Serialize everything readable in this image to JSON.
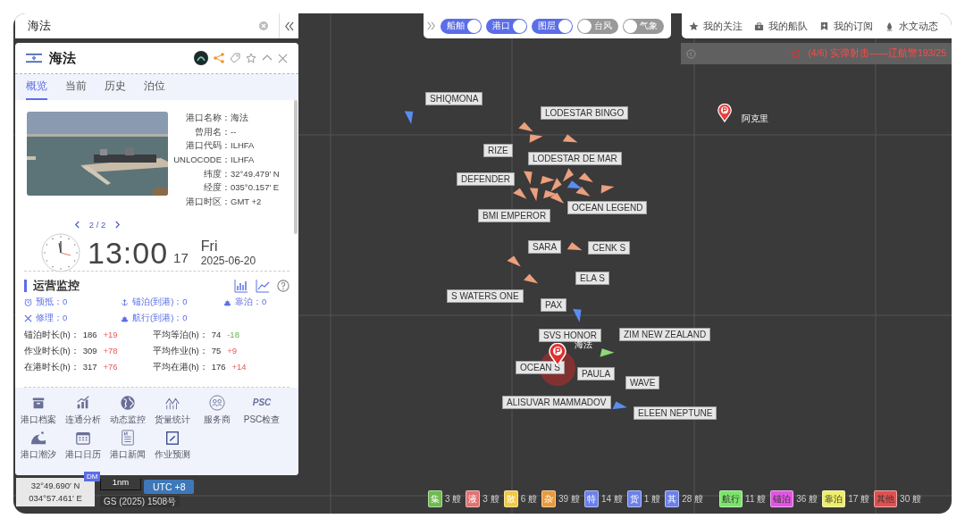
{
  "search": {
    "value": "海法"
  },
  "port_card": {
    "title": "海法",
    "tabs": [
      {
        "label": "概览",
        "selected": true
      },
      {
        "label": "当前",
        "selected": false
      },
      {
        "label": "历史",
        "selected": false
      },
      {
        "label": "泊位",
        "selected": false
      }
    ],
    "info": [
      {
        "label": "港口名称：",
        "value": "海法"
      },
      {
        "label": "曾用名：",
        "value": "--"
      },
      {
        "label": "港口代码：",
        "value": "ILHFA"
      },
      {
        "label": "UNLOCODE：",
        "value": "ILHFA"
      },
      {
        "label": "纬度：",
        "value": "32°49.479′ N"
      },
      {
        "label": "经度：",
        "value": "035°0.157′ E"
      },
      {
        "label": "港口时区：",
        "value": "GMT +2"
      }
    ],
    "pager": "2 / 2",
    "clock": {
      "time": "13:00",
      "seconds": "17",
      "weekday": "Fri",
      "date": "2025-06-20"
    },
    "operations": {
      "title": "运营监控",
      "status": [
        {
          "kind": "alarm",
          "label": "预抵：",
          "value": "0"
        },
        {
          "kind": "anchor",
          "label": "锚泊(到港)：",
          "value": "0"
        },
        {
          "kind": "ship",
          "label": "靠泊：",
          "value": "0"
        },
        {
          "kind": "repair",
          "label": "修理：",
          "value": "0"
        },
        {
          "kind": "ship",
          "label": "航行(到港)：",
          "value": "0"
        }
      ],
      "metrics": [
        {
          "label": "锚泊时长(h)：",
          "value": "186",
          "change": "+19",
          "kind": "rise"
        },
        {
          "label": "平均等泊(h)：",
          "value": "74",
          "change": "-18",
          "kind": "fall"
        },
        {
          "label": "作业时长(h)：",
          "value": "309",
          "change": "+78",
          "kind": "rise"
        },
        {
          "label": "平均作业(h)：",
          "value": "75",
          "change": "+9",
          "kind": "rise"
        },
        {
          "label": "在港时长(h)：",
          "value": "317",
          "change": "+76",
          "kind": "rise"
        },
        {
          "label": "平均在港(h)：",
          "value": "176",
          "change": "+14",
          "kind": "rise"
        }
      ]
    },
    "shortcuts": [
      {
        "kind": "archive",
        "label": "港口档案"
      },
      {
        "kind": "bars",
        "label": "连通分析"
      },
      {
        "kind": "globe",
        "label": "动态监控"
      },
      {
        "kind": "stats",
        "label": "货量统计"
      },
      {
        "kind": "people",
        "label": "服务商"
      },
      {
        "kind": "text",
        "icon_text": "PSC",
        "label": "PSC检查"
      },
      {
        "kind": "wave",
        "label": "港口潮汐"
      },
      {
        "kind": "calendar",
        "label": "港口日历"
      },
      {
        "kind": "news",
        "label": "港口新闻"
      },
      {
        "kind": "edit",
        "label": "作业预测"
      }
    ]
  },
  "map_controls": {
    "coordinates": [
      "32°49.690′ N",
      "034°57.461′ E"
    ],
    "badge": "DM",
    "scale": "1nm",
    "timezone": "UTC +8",
    "approval": "GS (2025) 1508号"
  },
  "layer_toggles": [
    {
      "label": "船舶",
      "on": true
    },
    {
      "label": "港口",
      "on": true
    },
    {
      "label": "图层",
      "on": true
    },
    {
      "label": "台风",
      "on": false
    },
    {
      "label": "气象",
      "on": false
    }
  ],
  "top_menu": [
    {
      "kind": "star",
      "label": "我的关注"
    },
    {
      "kind": "fleet",
      "label": "我的船队"
    },
    {
      "kind": "bookmark",
      "label": "我的订阅"
    },
    {
      "kind": "hydro",
      "label": "水文动态"
    }
  ],
  "notice": "(4/6) 实弹射击——辽航警193/25",
  "map_labels": {
    "ships": [
      "SHIQMONA",
      "LODESTAR BINGO",
      "RIZE",
      "LODESTAR DE MAR",
      "DEFENDER",
      "BMI EMPEROR",
      "OCEAN LEGEND",
      "SARA",
      "CENK S",
      "ELA S",
      "S WATERS ONE",
      "PAX",
      "SVS HONOR",
      "ZIM NEW ZEALAND",
      "OCEAN S",
      "PAULA",
      "WAVE",
      "ALISUVAR MAMMADOV",
      "ELEEN NEPTUNE"
    ],
    "ports": [
      {
        "name": "阿克里",
        "selected": false
      },
      {
        "name": "海法",
        "selected": true
      }
    ]
  },
  "legend": {
    "ship_types": [
      {
        "label": "集",
        "count": "3 艘",
        "color": "#6dbb4f"
      },
      {
        "label": "液",
        "count": "3 艘",
        "color": "#e07272"
      },
      {
        "label": "散",
        "count": "6 艘",
        "color": "#f2c843"
      },
      {
        "label": "杂",
        "count": "39 艘",
        "color": "#e89a3c"
      },
      {
        "label": "特",
        "count": "14 艘",
        "color": "#6b80ea"
      },
      {
        "label": "货",
        "count": "1 艘",
        "color": "#6b80ea"
      },
      {
        "label": "其",
        "count": "28 艘",
        "color": "#6b80ea"
      }
    ],
    "ship_states": [
      {
        "label": "航行",
        "count": "11 艘",
        "color": "#7be36a"
      },
      {
        "label": "锚泊",
        "count": "36 艘",
        "color": "#e056e0"
      },
      {
        "label": "靠泊",
        "count": "17 艘",
        "color": "#eeee6a"
      },
      {
        "label": "其他",
        "count": "30 艘",
        "color": "#e05050"
      }
    ]
  }
}
